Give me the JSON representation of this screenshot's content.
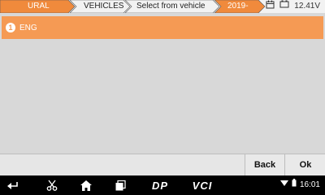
{
  "breadcrumbs": [
    {
      "label": "URAL"
    },
    {
      "label": "VEHICLES"
    },
    {
      "label": "Select from vehicle"
    },
    {
      "label": "2019-"
    }
  ],
  "status": {
    "voltage": "12.41V",
    "calendar_icon": "calendar-icon",
    "battery_icon": "battery-icon"
  },
  "list": {
    "items": [
      {
        "index": "1",
        "label": "ENG"
      }
    ]
  },
  "buttons": {
    "back": "Back",
    "ok": "Ok"
  },
  "navbar": {
    "dp_label": "DP",
    "vci_label": "VCI",
    "time": "16:01"
  },
  "colors": {
    "accent": "#f59a54",
    "tab_active": "#f08a3c"
  }
}
